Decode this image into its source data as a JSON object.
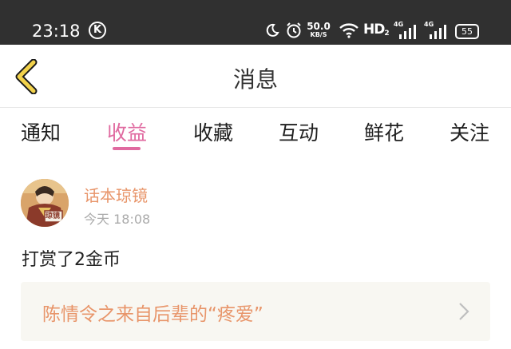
{
  "status_bar": {
    "time": "23:18",
    "carrier_icon": "k-circle-icon",
    "net_speed_value": "50.0",
    "net_speed_unit": "KB/S",
    "hd_label": "HD",
    "hd_sub": "2",
    "signal_1_label": "4G",
    "signal_2_label": "4G",
    "battery": "55"
  },
  "header": {
    "title": "消息",
    "back_icon": "chevron-left-icon"
  },
  "tabs": [
    {
      "label": "通知",
      "active": false
    },
    {
      "label": "收益",
      "active": true
    },
    {
      "label": "收藏",
      "active": false
    },
    {
      "label": "互动",
      "active": false
    },
    {
      "label": "鲜花",
      "active": false
    },
    {
      "label": "关注",
      "active": false
    }
  ],
  "message": {
    "sender": "话本琼镜",
    "time": "今天 18:08",
    "text": "打赏了2金币",
    "avatar_badge": "琼镜",
    "work_title": "陈情令之来自后辈的“疼爱”"
  },
  "colors": {
    "accent": "#e06aa0",
    "name_orange": "#e8956a",
    "back_yellow": "#f2d24b",
    "status_bar_bg": "#303030"
  }
}
